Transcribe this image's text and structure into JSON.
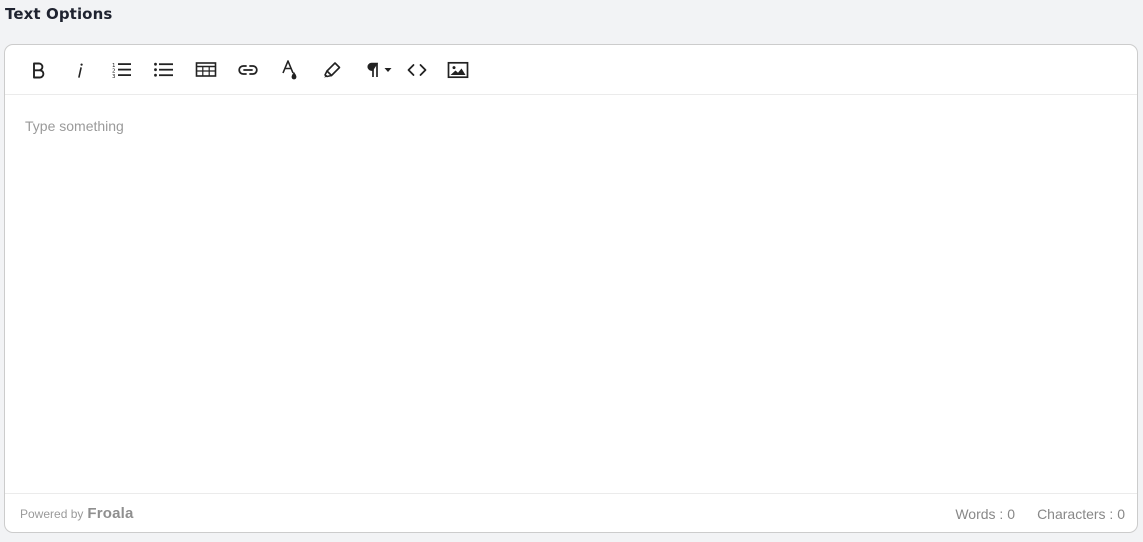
{
  "section": {
    "title": "Text Options"
  },
  "toolbar": {
    "buttons": [
      {
        "name": "bold",
        "icon": "bold-icon"
      },
      {
        "name": "italic",
        "icon": "italic-icon"
      },
      {
        "name": "ordered-list",
        "icon": "ordered-list-icon"
      },
      {
        "name": "unordered-list",
        "icon": "unordered-list-icon"
      },
      {
        "name": "insert-table",
        "icon": "table-icon"
      },
      {
        "name": "insert-link",
        "icon": "link-icon"
      },
      {
        "name": "text-color",
        "icon": "text-color-icon"
      },
      {
        "name": "highlight",
        "icon": "highlighter-icon"
      },
      {
        "name": "paragraph-format",
        "icon": "paragraph-icon"
      },
      {
        "name": "code-view",
        "icon": "code-icon"
      },
      {
        "name": "insert-image",
        "icon": "image-icon"
      }
    ]
  },
  "editor": {
    "placeholder": "Type something"
  },
  "footer": {
    "powered_by": "Powered by",
    "brand": "Froala",
    "words": "Words : 0",
    "characters": "Characters : 0"
  },
  "colors": {
    "page_background": "#f2f3f5",
    "editor_background": "#ffffff",
    "border": "#cccccc",
    "icon": "#222222",
    "placeholder": "#9a9a9a"
  }
}
